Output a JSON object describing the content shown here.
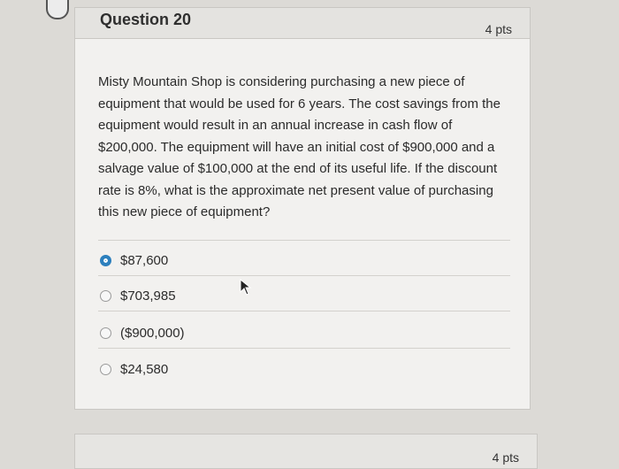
{
  "question": {
    "title": "Question 20",
    "points": "4 pts",
    "text": "Misty Mountain Shop is considering purchasing a new piece of equipment that would be used for 6 years. The cost savings from the equipment would result in an annual increase in cash flow of $200,000. The equipment will have an initial cost of $900,000 and a salvage value of $100,000 at the end of its useful life. If the discount rate is 8%, what is the approximate net present value of purchasing this new piece of equipment?",
    "answers": [
      {
        "label": "$87,600",
        "selected": true
      },
      {
        "label": "$703,985",
        "selected": false
      },
      {
        "label": "($900,000)",
        "selected": false
      },
      {
        "label": "$24,580",
        "selected": false
      }
    ]
  },
  "next_question": {
    "points": "4 pts"
  },
  "colors": {
    "selected_radio": "#2c7fbd",
    "background": "#dcdad6",
    "card": "#f2f1ef"
  },
  "icons": {
    "cursor": "mouse-pointer-icon"
  }
}
